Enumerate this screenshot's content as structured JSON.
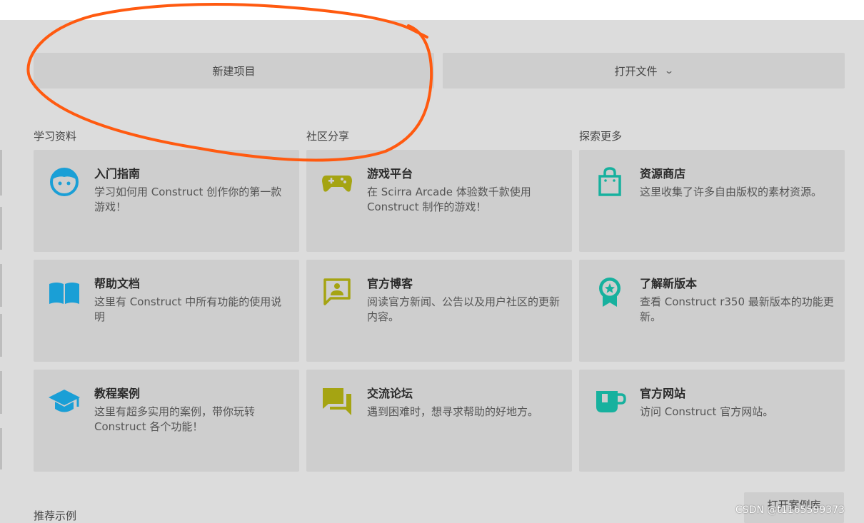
{
  "actions": {
    "new_project": "新建项目",
    "open_file": "打开文件"
  },
  "sections": {
    "learn": "学习资料",
    "community": "社区分享",
    "explore": "探索更多"
  },
  "cards": [
    {
      "title": "入门指南",
      "desc": "学习如何用 Construct 创作你的第一款游戏！",
      "icon": "face-icon",
      "color": "#1a9fd6"
    },
    {
      "title": "游戏平台",
      "desc": "在 Scirra Arcade 体验数千款使用 Construct 制作的游戏！",
      "icon": "gamepad-icon",
      "color": "#a5a412"
    },
    {
      "title": "资源商店",
      "desc": "这里收集了许多自由版权的素材资源。",
      "icon": "shopping-bag-icon",
      "color": "#17b19e"
    },
    {
      "title": "帮助文档",
      "desc": "这里有 Construct 中所有功能的使用说明",
      "icon": "book-icon",
      "color": "#1a9fd6"
    },
    {
      "title": "官方博客",
      "desc": "阅读官方新闻、公告以及用户社区的更新内容。",
      "icon": "chat-person-icon",
      "color": "#a5a412"
    },
    {
      "title": "了解新版本",
      "desc": "查看 Construct r350 最新版本的功能更新。",
      "icon": "award-icon",
      "color": "#17b19e"
    },
    {
      "title": "教程案例",
      "desc": "这里有超多实用的案例，带你玩转 Construct 各个功能！",
      "icon": "graduation-cap-icon",
      "color": "#1a9fd6"
    },
    {
      "title": "交流论坛",
      "desc": "遇到困难时，想寻求帮助的好地方。",
      "icon": "forum-icon",
      "color": "#a5a412"
    },
    {
      "title": "官方网站",
      "desc": "访问 Construct 官方网站。",
      "icon": "mug-icon",
      "color": "#17b19e"
    }
  ],
  "examples": {
    "label": "推荐示例",
    "open_library": "打开案例库"
  },
  "watermark": "CSDN @t1165599373",
  "annotation_color": "#ff5a10"
}
